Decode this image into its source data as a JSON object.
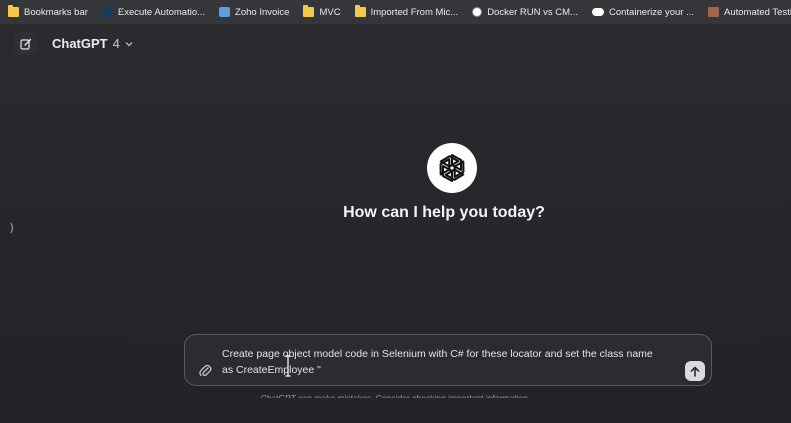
{
  "bookmarks": [
    {
      "label": "Bookmarks bar",
      "icon": "folder-icon"
    },
    {
      "label": "Execute Automatio...",
      "icon": "executeautomation-icon"
    },
    {
      "label": "Zoho Invoice",
      "icon": "zoho-icon"
    },
    {
      "label": "MVC",
      "icon": "folder-icon"
    },
    {
      "label": "Imported From Mic...",
      "icon": "folder-icon"
    },
    {
      "label": "Docker RUN vs CM...",
      "icon": "docker-site-icon"
    },
    {
      "label": "Containerize your ...",
      "icon": "medium-icon"
    },
    {
      "label": "Automated Testing...",
      "icon": "avatar-favicon-icon"
    }
  ],
  "header": {
    "model_name": "ChatGPT",
    "model_version": "4",
    "new_chat_icon": "edit-icon",
    "model_chevron_icon": "chevron-down-icon"
  },
  "hero": {
    "logo_icon": "openai-logo-icon",
    "title": "How can I help you today?"
  },
  "composer": {
    "line1": "Create page object model code in Selenium with C# for these locator and set the class name",
    "line2": "as CreateEmployee \"",
    "attach_icon": "paperclip-icon",
    "send_icon": "arrow-up-icon"
  },
  "footer": {
    "note": "ChatGPT can make mistakes. Consider checking important information."
  },
  "colors": {
    "background": "#242428",
    "bookmarks_bar": "#35363a",
    "composer_border": "#5a5a62",
    "send_button": "#d9d9de"
  }
}
